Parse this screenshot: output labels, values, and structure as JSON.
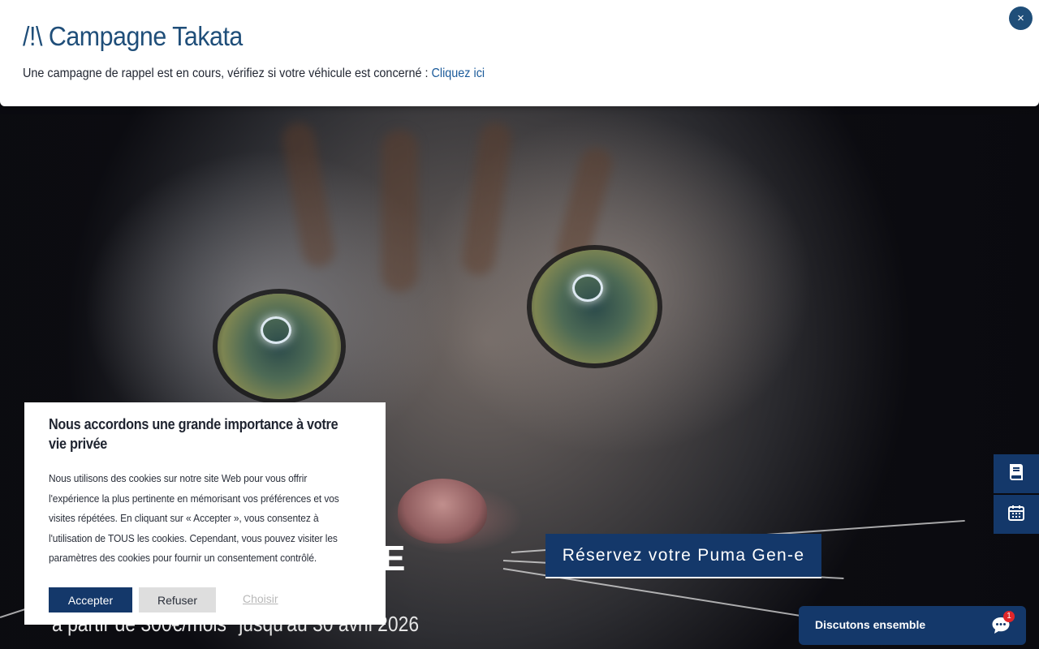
{
  "banner": {
    "title": "/!\\ Campagne Takata",
    "text": "Une campagne de rappel est en cours, vérifiez si votre véhicule est concerné : ",
    "link_label": "Cliquez ici",
    "close_glyph": "×"
  },
  "hero": {
    "partial_title": "E",
    "subtitle": "à partir de 300€/mois* jusqu'au 30 avril 2026",
    "cta_label": "Réservez votre Puma Gen-e"
  },
  "side_buttons": [
    {
      "icon": "book-icon"
    },
    {
      "icon": "calendar-icon"
    }
  ],
  "cookie": {
    "title": "Nous accordons une grande importance à votre vie privée",
    "body": "Nous utilisons des cookies sur notre site Web pour vous offrir l'expérience la plus pertinente en mémorisant vos préférences et vos visites répétées. En cliquant sur « Accepter », vous consentez à l'utilisation de TOUS les cookies. Cependant, vous pouvez visiter les paramètres des cookies pour fournir un consentement contrôlé.",
    "accept_label": "Accepter",
    "refuse_label": "Refuser",
    "choose_label": "Choisir"
  },
  "chat": {
    "label": "Discutons ensemble",
    "badge_count": "1",
    "icon": "chat-bubble-icon"
  },
  "colors": {
    "brand_blue": "#14386a",
    "title_blue": "#1f4e79",
    "link_blue": "#1a5a9a",
    "badge_red": "#e0262a"
  }
}
